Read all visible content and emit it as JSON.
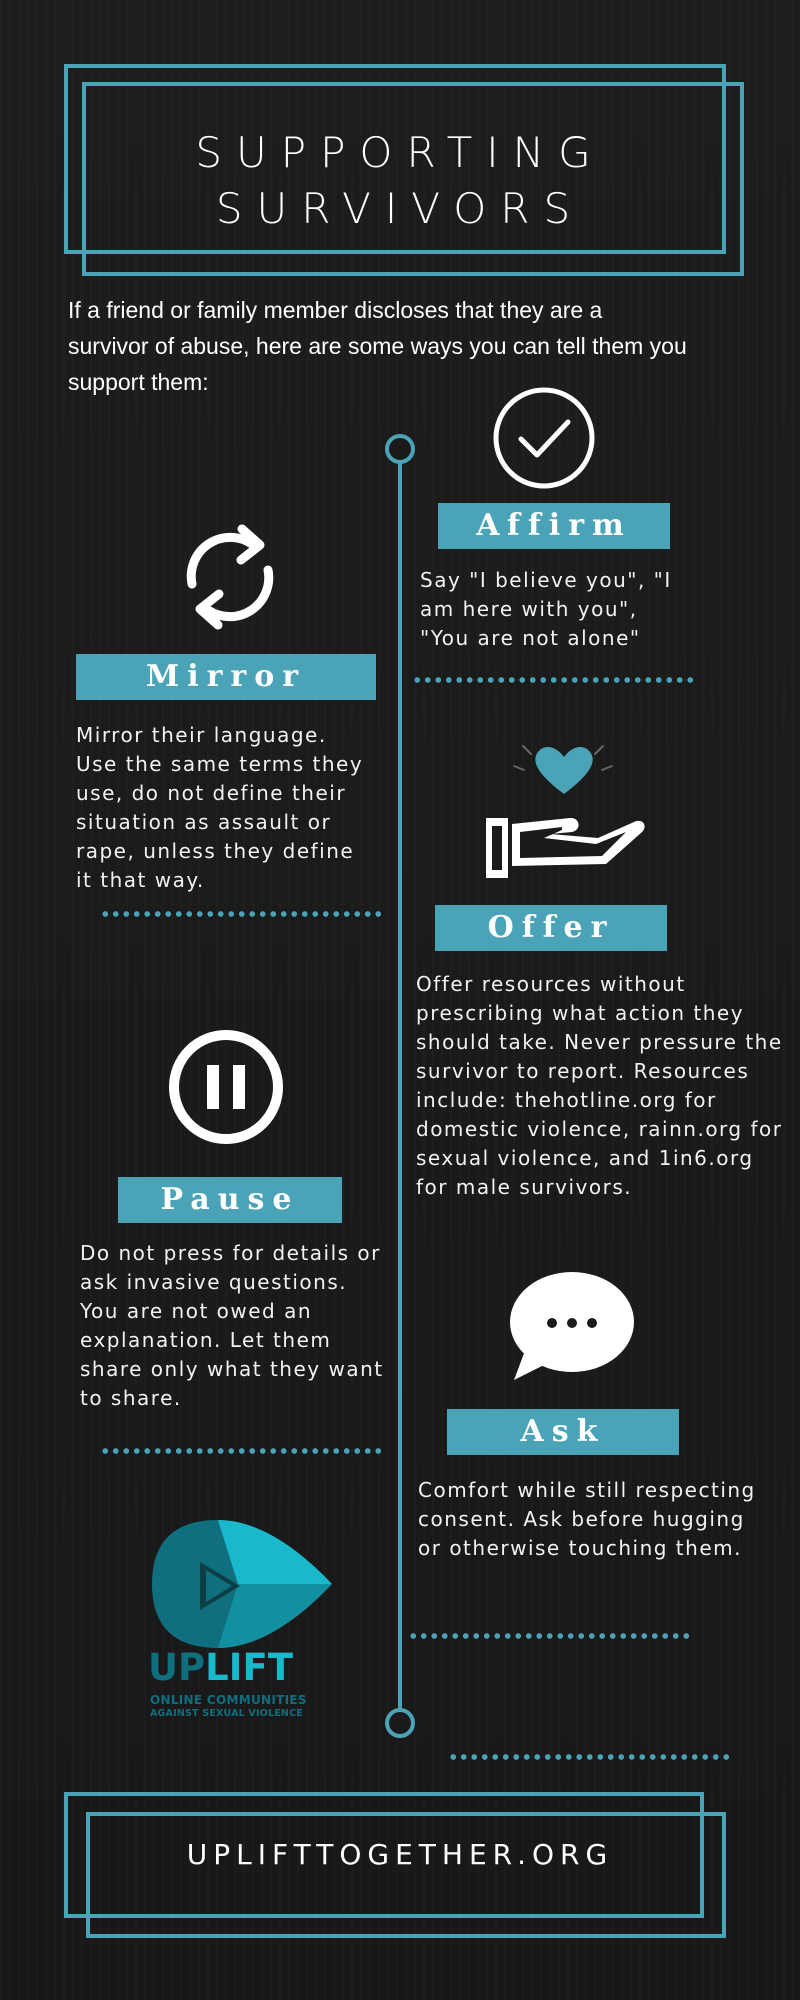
{
  "header": {
    "title_line1": "SUPPORTING",
    "title_line2": "SURVIVORS"
  },
  "intro": "If a friend or family member discloses that they are a survivor of abuse, here are some ways you can tell them you support them:",
  "steps": {
    "affirm": {
      "label": "Affirm",
      "text": "Say \"I believe you\", \"I am here with you\", \"You are not alone\"",
      "icon": "checkmark-circle-icon"
    },
    "mirror": {
      "label": "Mirror",
      "text": "Mirror their language. Use the same terms they use, do not define their situation as assault or rape, unless they define it that way.",
      "icon": "refresh-cycle-icon"
    },
    "offer": {
      "label": "Offer",
      "text": "Offer resources without prescribing what action they should take. Never pressure the survivor to report. Resources include: thehotline.org for domestic violence, rainn.org for sexual violence, and 1in6.org for male survivors.",
      "icon": "hand-heart-icon"
    },
    "pause": {
      "label": "Pause",
      "text": "Do not press for details or ask invasive questions. You are not owed an explanation. Let them share only what they want to share.",
      "icon": "pause-circle-icon"
    },
    "ask": {
      "label": "Ask",
      "text": "Comfort while still respecting consent. Ask before hugging or otherwise touching them.",
      "icon": "speech-bubble-icon"
    }
  },
  "logo": {
    "name_part1": "UP",
    "name_part2": "LIFT",
    "tagline1": "ONLINE COMMUNITIES",
    "tagline2": "AGAINST SEXUAL VIOLENCE"
  },
  "footer": {
    "url": "UPLIFTTOGETHER.ORG"
  },
  "colors": {
    "accent": "#4aa3b7",
    "background": "#1b1b1b",
    "logo_cyan": "#19b8cc",
    "logo_dark": "#0f6f7e"
  }
}
